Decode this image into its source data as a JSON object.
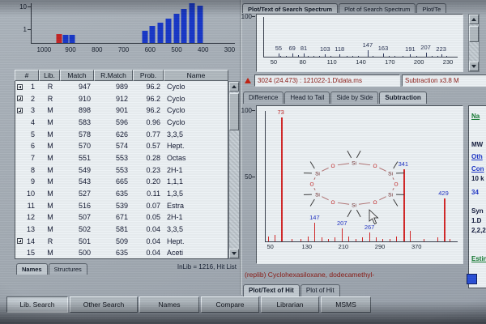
{
  "colors": {
    "bar_blue": "#1838c8",
    "bar_red": "#c42424",
    "peak_red": "#d42828",
    "peak_dark": "#323c5e",
    "label_blue": "#2234c4",
    "label_red": "#c02020",
    "maroon": "#8c1a14",
    "green": "#127830",
    "navy": "#121a3c",
    "blue": "#2038c8"
  },
  "top_tabs": {
    "labels": [
      "Plot/Text of Search Spectrum",
      "Plot of Search Spectrum",
      "Plot/Te"
    ],
    "selected": 0
  },
  "compare_tabs": {
    "labels": [
      "Difference",
      "Head to Tail",
      "Side by Side",
      "Subtraction"
    ],
    "selected": 3
  },
  "hit_tabs": {
    "labels": [
      "Plot/Text of Hit",
      "Plot of Hit"
    ],
    "selected": 0
  },
  "hitlist_tabs": {
    "labels": [
      "Names",
      "Structures"
    ],
    "selected": 0
  },
  "file_bar": {
    "marker_icon": "red-triangle-up",
    "file_text": "3024 (24.473) : 121022-1.D\\data.ms",
    "right_text": "Subtraction x3.8 M"
  },
  "hitlist": {
    "columns": [
      "#",
      "Lib.",
      "Match",
      "R.Match",
      "Prob.",
      "Name"
    ],
    "status": "InLib = 1216, Hit List",
    "rows": [
      {
        "plus": true,
        "num": "1",
        "lib": "R",
        "match": "947",
        "rmatch": "989",
        "prob": "96.2",
        "name": "Cyclo"
      },
      {
        "plus": true,
        "num": "2",
        "lib": "R",
        "match": "910",
        "rmatch": "912",
        "prob": "96.2",
        "name": "Cyclo"
      },
      {
        "plus": true,
        "num": "3",
        "lib": "M",
        "match": "898",
        "rmatch": "901",
        "prob": "96.2",
        "name": "Cyclo"
      },
      {
        "plus": false,
        "num": "4",
        "lib": "M",
        "match": "583",
        "rmatch": "596",
        "prob": "0.96",
        "name": "Cyclo"
      },
      {
        "plus": false,
        "num": "5",
        "lib": "M",
        "match": "578",
        "rmatch": "626",
        "prob": "0.77",
        "name": "3,3,5"
      },
      {
        "plus": false,
        "num": "6",
        "lib": "M",
        "match": "570",
        "rmatch": "574",
        "prob": "0.57",
        "name": "Hept."
      },
      {
        "plus": false,
        "num": "7",
        "lib": "M",
        "match": "551",
        "rmatch": "553",
        "prob": "0.28",
        "name": "Octas"
      },
      {
        "plus": false,
        "num": "8",
        "lib": "M",
        "match": "549",
        "rmatch": "553",
        "prob": "0.23",
        "name": "2H-1"
      },
      {
        "plus": false,
        "num": "9",
        "lib": "M",
        "match": "543",
        "rmatch": "665",
        "prob": "0.20",
        "name": "1,1,1"
      },
      {
        "plus": false,
        "num": "10",
        "lib": "M",
        "match": "527",
        "rmatch": "635",
        "prob": "0.11",
        "name": "1,3,5"
      },
      {
        "plus": false,
        "num": "11",
        "lib": "M",
        "match": "516",
        "rmatch": "539",
        "prob": "0.07",
        "name": "Estra"
      },
      {
        "plus": false,
        "num": "12",
        "lib": "M",
        "match": "507",
        "rmatch": "671",
        "prob": "0.05",
        "name": "2H-1"
      },
      {
        "plus": false,
        "num": "13",
        "lib": "M",
        "match": "502",
        "rmatch": "581",
        "prob": "0.04",
        "name": "3,3,5"
      },
      {
        "plus": true,
        "num": "14",
        "lib": "R",
        "match": "501",
        "rmatch": "509",
        "prob": "0.04",
        "name": "Hept."
      },
      {
        "plus": false,
        "num": "15",
        "lib": "M",
        "match": "500",
        "rmatch": "635",
        "prob": "0.04",
        "name": "Aceti"
      }
    ]
  },
  "info_panel": {
    "lines": [
      {
        "t": "Na",
        "c": "green",
        "u": true,
        "mt": 8
      },
      {
        "t": "MW",
        "c": "navy",
        "u": false,
        "mt": 26
      },
      {
        "t": "Oth",
        "c": "blue",
        "u": true,
        "mt": 6
      },
      {
        "t": "Con",
        "c": "blue",
        "u": true,
        "mt": 6
      },
      {
        "t": "10 k",
        "c": "navy",
        "u": false,
        "mt": 3
      },
      {
        "t": "34",
        "c": "blue",
        "u": false,
        "mt": 8
      },
      {
        "t": "Syn",
        "c": "navy",
        "u": false,
        "mt": 14
      },
      {
        "t": "1.D",
        "c": "navy",
        "u": false,
        "mt": 3
      },
      {
        "t": "2,2,2",
        "c": "navy",
        "u": false,
        "mt": 3
      },
      {
        "t": "Estin",
        "c": "green",
        "u": true,
        "mt": 26
      }
    ]
  },
  "toolbar": {
    "buttons": [
      "Lib. Search",
      "Other Search",
      "Names",
      "Compare",
      "Librarian",
      "MSMS"
    ],
    "selected": 0
  },
  "chart_data": [
    {
      "id": "hit-histogram",
      "type": "bar",
      "x_ticks": [
        "1000",
        "900",
        "800",
        "700",
        "600",
        "500",
        "400",
        "300"
      ],
      "y_ticks": [
        "10",
        "1"
      ],
      "x_range": [
        1050,
        280
      ],
      "ylog": true,
      "bars": [
        {
          "x": 947,
          "h": 0.22,
          "c": "red"
        },
        {
          "x": 920,
          "h": 0.2,
          "c": "blue"
        },
        {
          "x": 898,
          "h": 0.2,
          "c": "blue"
        },
        {
          "x": 622,
          "h": 0.3,
          "c": "blue"
        },
        {
          "x": 592,
          "h": 0.42,
          "c": "blue"
        },
        {
          "x": 562,
          "h": 0.52,
          "c": "blue"
        },
        {
          "x": 532,
          "h": 0.62,
          "c": "blue"
        },
        {
          "x": 502,
          "h": 0.74,
          "c": "blue"
        },
        {
          "x": 472,
          "h": 0.86,
          "c": "blue"
        },
        {
          "x": 442,
          "h": 1.0,
          "c": "blue"
        },
        {
          "x": 412,
          "h": 0.94,
          "c": "blue"
        }
      ]
    },
    {
      "id": "search-spectrum",
      "type": "stick",
      "x_range": [
        40,
        240
      ],
      "x_ticks": [
        "50",
        "80",
        "110",
        "140",
        "170",
        "200",
        "230"
      ],
      "y_ticks": [
        "100"
      ],
      "peaks": [
        {
          "mz": 55,
          "i": 8,
          "label": "55"
        },
        {
          "mz": 69,
          "i": 9,
          "label": "69"
        },
        {
          "mz": 81,
          "i": 9,
          "label": "81"
        },
        {
          "mz": 103,
          "i": 7,
          "label": "103"
        },
        {
          "mz": 118,
          "i": 6,
          "label": "118"
        },
        {
          "mz": 147,
          "i": 16,
          "label": "147"
        },
        {
          "mz": 163,
          "i": 8,
          "label": "163"
        },
        {
          "mz": 191,
          "i": 6,
          "label": "191"
        },
        {
          "mz": 207,
          "i": 10,
          "label": "207"
        },
        {
          "mz": 223,
          "i": 7,
          "label": "223"
        }
      ],
      "minor_peaks": [
        {
          "mz": 57,
          "i": 3
        },
        {
          "mz": 63,
          "i": 2
        },
        {
          "mz": 75,
          "i": 4
        },
        {
          "mz": 85,
          "i": 3
        },
        {
          "mz": 91,
          "i": 2
        },
        {
          "mz": 97,
          "i": 3
        },
        {
          "mz": 109,
          "i": 3
        },
        {
          "mz": 125,
          "i": 2
        },
        {
          "mz": 131,
          "i": 3
        },
        {
          "mz": 137,
          "i": 2
        },
        {
          "mz": 152,
          "i": 3
        },
        {
          "mz": 169,
          "i": 2
        },
        {
          "mz": 175,
          "i": 2
        },
        {
          "mz": 183,
          "i": 2
        },
        {
          "mz": 197,
          "i": 3
        },
        {
          "mz": 213,
          "i": 2
        },
        {
          "mz": 219,
          "i": 2
        },
        {
          "mz": 228,
          "i": 2
        }
      ]
    },
    {
      "id": "hit-spectrum",
      "type": "stick",
      "x_range": [
        40,
        460
      ],
      "x_ticks": [
        "50",
        "130",
        "210",
        "290",
        "370"
      ],
      "y_ticks": [
        "100",
        "50"
      ],
      "compound": "(replib) Cyclohexasiloxane, dodecamethyl-",
      "peaks": [
        {
          "mz": 73,
          "i": 95,
          "label": "73",
          "label_color": "red"
        },
        {
          "mz": 147,
          "i": 14,
          "label": "147",
          "label_color": "blue"
        },
        {
          "mz": 207,
          "i": 10,
          "label": "207",
          "label_color": "blue"
        },
        {
          "mz": 267,
          "i": 7,
          "label": "267",
          "label_color": "blue"
        },
        {
          "mz": 341,
          "i": 55,
          "label": "341",
          "label_color": "blue"
        },
        {
          "mz": 429,
          "i": 33,
          "label": "429",
          "label_color": "blue"
        }
      ],
      "minor_peaks": [
        {
          "mz": 45,
          "i": 4
        },
        {
          "mz": 59,
          "i": 5
        },
        {
          "mz": 96,
          "i": 2
        },
        {
          "mz": 117,
          "i": 2
        },
        {
          "mz": 133,
          "i": 4
        },
        {
          "mz": 163,
          "i": 3
        },
        {
          "mz": 177,
          "i": 2
        },
        {
          "mz": 191,
          "i": 3
        },
        {
          "mz": 221,
          "i": 4
        },
        {
          "mz": 237,
          "i": 2
        },
        {
          "mz": 251,
          "i": 3
        },
        {
          "mz": 281,
          "i": 3
        },
        {
          "mz": 295,
          "i": 2
        },
        {
          "mz": 311,
          "i": 2
        },
        {
          "mz": 325,
          "i": 4
        },
        {
          "mz": 355,
          "i": 8
        },
        {
          "mz": 385,
          "i": 2
        },
        {
          "mz": 415,
          "i": 3
        },
        {
          "mz": 443,
          "i": 2
        }
      ],
      "structure": {
        "atoms": [
          "Si",
          "O",
          "Si",
          "O",
          "Si",
          "O",
          "Si",
          "O",
          "Si",
          "O",
          "Si",
          "O"
        ]
      }
    }
  ]
}
